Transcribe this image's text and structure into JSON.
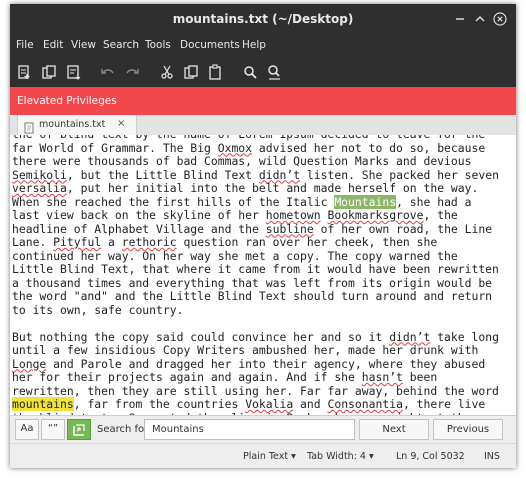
{
  "window": {
    "title": "mountains.txt (~/Desktop)",
    "controls": [
      "minimize-icon",
      "maximize-icon",
      "close-icon"
    ]
  },
  "menu": [
    "File",
    "Edit",
    "View",
    "Search",
    "Tools",
    "Documents",
    "Help"
  ],
  "toolbar": [
    "new-document-icon",
    "open-icon",
    "save-icon",
    "undo-icon",
    "redo-icon",
    "cut-icon",
    "copy-icon",
    "paste-icon",
    "find-icon",
    "find-replace-icon"
  ],
  "banner": {
    "text": "Elevated Privileges",
    "color": "#f2474b"
  },
  "tab": {
    "label": "mountains.txt",
    "close": "×"
  },
  "editor": {
    "lines": [
      [
        {
          "t": "the of blind text by the name of Lorem Ipsum decided to leave for the"
        }
      ],
      [
        {
          "t": "far World of Grammar. The Big "
        },
        {
          "t": "Oxmox",
          "s": "sp"
        },
        {
          "t": " advised her not to do so, because"
        }
      ],
      [
        {
          "t": "there were thousands of bad Commas, wild Question Marks and devious"
        }
      ],
      [
        {
          "t": "Semikoli",
          "s": "sp"
        },
        {
          "t": ", but the Little Blind Text "
        },
        {
          "t": "didn’t",
          "s": "sp"
        },
        {
          "t": " listen. She packed her seven"
        }
      ],
      [
        {
          "t": "versalia",
          "s": "sp"
        },
        {
          "t": ", put her initial into the belt and made herself on the way."
        }
      ],
      [
        {
          "t": "When she reached the first hills of the Italic "
        },
        {
          "t": "Mountains",
          "s": "hl-sel"
        },
        {
          "t": ", she had a"
        }
      ],
      [
        {
          "t": "last view back on the skyline of her "
        },
        {
          "t": "hometown",
          "s": "sp"
        },
        {
          "t": " "
        },
        {
          "t": "Bookmarksgrove",
          "s": "sp"
        },
        {
          "t": ", the"
        }
      ],
      [
        {
          "t": "headline of Alphabet Village and the "
        },
        {
          "t": "subline",
          "s": "sp"
        },
        {
          "t": " of her own road, the Line"
        }
      ],
      [
        {
          "t": "Lane. "
        },
        {
          "t": "Pityful",
          "s": "sp"
        },
        {
          "t": " a "
        },
        {
          "t": "rethoric",
          "s": "sp"
        },
        {
          "t": " question ran over her cheek, then she"
        }
      ],
      [
        {
          "t": "continued her way. On her way she met a copy. The copy warned the"
        }
      ],
      [
        {
          "t": "Little Blind Text, that where it came from it would have been rewritten"
        }
      ],
      [
        {
          "t": "a thousand times and everything that was left from its origin would be"
        }
      ],
      [
        {
          "t": "the word \"and\" and the Little Blind Text should turn around and return"
        }
      ],
      [
        {
          "t": "to its own, safe country."
        }
      ],
      [
        {
          "t": ""
        }
      ],
      [
        {
          "t": "But nothing the copy said could convince her and so it "
        },
        {
          "t": "didn’t",
          "s": "sp"
        },
        {
          "t": " take long"
        }
      ],
      [
        {
          "t": "until a few insidious Copy Writers ambushed her, made her drunk with"
        }
      ],
      [
        {
          "t": "Longe",
          "s": "sp"
        },
        {
          "t": " and Parole and dragged her into their agency, where they abused"
        }
      ],
      [
        {
          "t": "her for their projects again and again. And if she "
        },
        {
          "t": "hasn’t",
          "s": "sp"
        },
        {
          "t": " been"
        }
      ],
      [
        {
          "t": "rewritten, then they are still using her. Far far away, behind the word"
        }
      ],
      [
        {
          "t": "mountains",
          "s": "hl-match"
        },
        {
          "t": ", far from the countries "
        },
        {
          "t": "Vokalia",
          "s": "sp"
        },
        {
          "t": " and "
        },
        {
          "t": "Consonantia",
          "s": "sp"
        },
        {
          "t": ", there live"
        }
      ],
      [
        {
          "t": "the blind texts. Separated they live in "
        },
        {
          "t": "Bookmarksgrove",
          "s": "sp"
        },
        {
          "t": " right at the"
        }
      ]
    ]
  },
  "findbar": {
    "case_label": "Aa",
    "whole_word_label": "“”",
    "label": "Search for:",
    "search_value": "Mountains",
    "next_label": "Next",
    "previous_label": "Previous"
  },
  "status": {
    "syntax": "Plain Text",
    "tab_width": "Tab Width: 4",
    "position": "Ln 9, Col 5032",
    "mode": "INS"
  }
}
